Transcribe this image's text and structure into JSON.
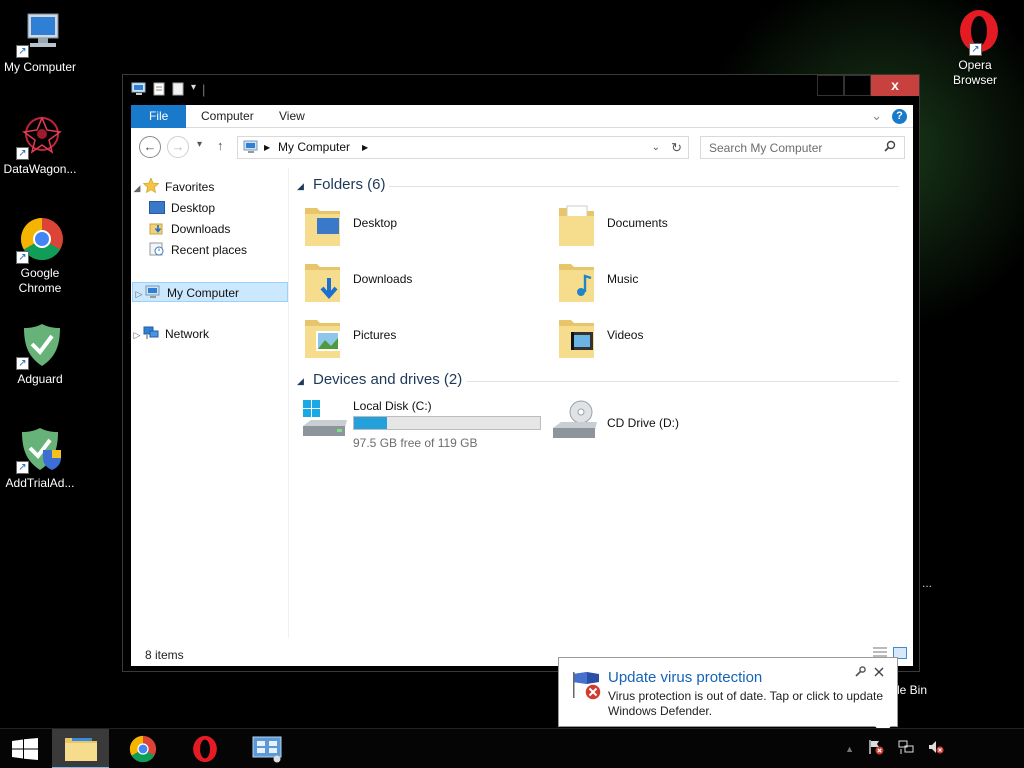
{
  "desktop": {
    "icons": [
      {
        "label": "My Computer",
        "icon": "computer-icon"
      },
      {
        "label": "DataWagon...",
        "icon": "datawagon-icon"
      },
      {
        "label": "Google Chrome",
        "icon": "chrome-icon"
      },
      {
        "label": "Adguard",
        "icon": "adguard-icon"
      },
      {
        "label": "AddTrialAd...",
        "icon": "addtrial-icon"
      },
      {
        "label": "Opera Browser",
        "icon": "opera-icon"
      }
    ],
    "recycle_bin_partial": "le Bin",
    "partial_dots": "..."
  },
  "window": {
    "title_bar": {
      "close": "x",
      "down_arrow": "▾"
    },
    "ribbon": {
      "tabs": [
        "File",
        "Computer",
        "View"
      ],
      "expand": "⌄",
      "help": "?"
    },
    "nav": {
      "back": "←",
      "forward": "→",
      "recent": "▾",
      "up": "↑",
      "address_segments": [
        "My Computer"
      ],
      "refresh": "↻",
      "search_placeholder": "Search My Computer"
    },
    "nav_pane": {
      "favorites": "Favorites",
      "fav_items": [
        "Desktop",
        "Downloads",
        "Recent places"
      ],
      "my_computer": "My Computer",
      "network": "Network"
    },
    "content": {
      "folders_heading": "Folders (6)",
      "folders": [
        {
          "name": "Desktop"
        },
        {
          "name": "Documents"
        },
        {
          "name": "Downloads"
        },
        {
          "name": "Music"
        },
        {
          "name": "Pictures"
        },
        {
          "name": "Videos"
        }
      ],
      "devices_heading": "Devices and drives (2)",
      "drives": [
        {
          "name": "Local Disk (C:)",
          "free_text": "97.5 GB free of 119 GB",
          "used_fraction": 0.18
        },
        {
          "name": "CD Drive (D:)"
        }
      ]
    },
    "status": {
      "item_count": "8 items"
    }
  },
  "toast": {
    "title": "Update virus protection",
    "body": "Virus protection is out of date. Tap or click to update Windows Defender."
  },
  "colors": {
    "accent": "#1979ca",
    "close_red": "#c7423e",
    "drive_fill": "#26a0da",
    "heading_blue": "#1e395b",
    "toast_title": "#1563b7"
  }
}
